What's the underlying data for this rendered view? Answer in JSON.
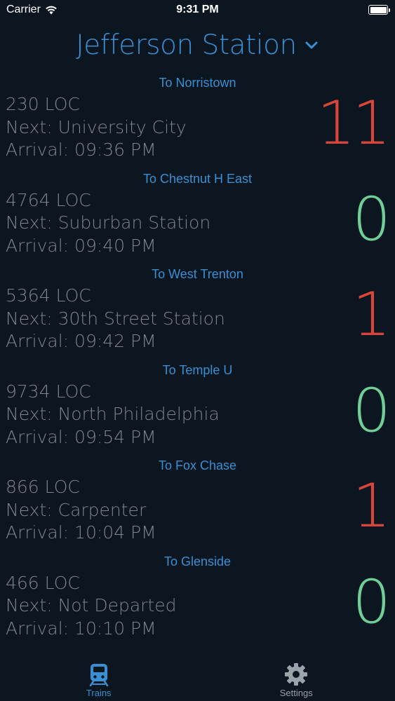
{
  "status": {
    "carrier": "Carrier",
    "time": "9:31 PM"
  },
  "header": {
    "station": "Jefferson Station"
  },
  "trains": [
    {
      "destination": "To Norristown",
      "train": "230 LOC",
      "next": "Next: University City",
      "arrival": "Arrival: 09:36 PM",
      "late": "11",
      "status": "late"
    },
    {
      "destination": "To Chestnut H East",
      "train": "4764 LOC",
      "next": "Next: Suburban Station",
      "arrival": "Arrival: 09:40 PM",
      "late": "0",
      "status": "ontime"
    },
    {
      "destination": "To West Trenton",
      "train": "5364 LOC",
      "next": "Next: 30th Street Station",
      "arrival": "Arrival: 09:42 PM",
      "late": "1",
      "status": "late"
    },
    {
      "destination": "To Temple U",
      "train": "9734 LOC",
      "next": "Next: North Philadelphia",
      "arrival": "Arrival: 09:54 PM",
      "late": "0",
      "status": "ontime"
    },
    {
      "destination": "To Fox Chase",
      "train": "866 LOC",
      "next": "Next: Carpenter",
      "arrival": "Arrival: 10:04 PM",
      "late": "1",
      "status": "late"
    },
    {
      "destination": "To Glenside",
      "train": "466 LOC",
      "next": "Next: Not Departed",
      "arrival": "Arrival: 10:10 PM",
      "late": "0",
      "status": "ontime"
    }
  ],
  "tabs": [
    {
      "label": "Trains",
      "icon": "train-icon"
    },
    {
      "label": "Settings",
      "icon": "gear-icon"
    }
  ],
  "colors": {
    "accent": "#3a8fd3",
    "late": "#d9453a",
    "ontime": "#6fcf97",
    "background": "#0b1621"
  }
}
